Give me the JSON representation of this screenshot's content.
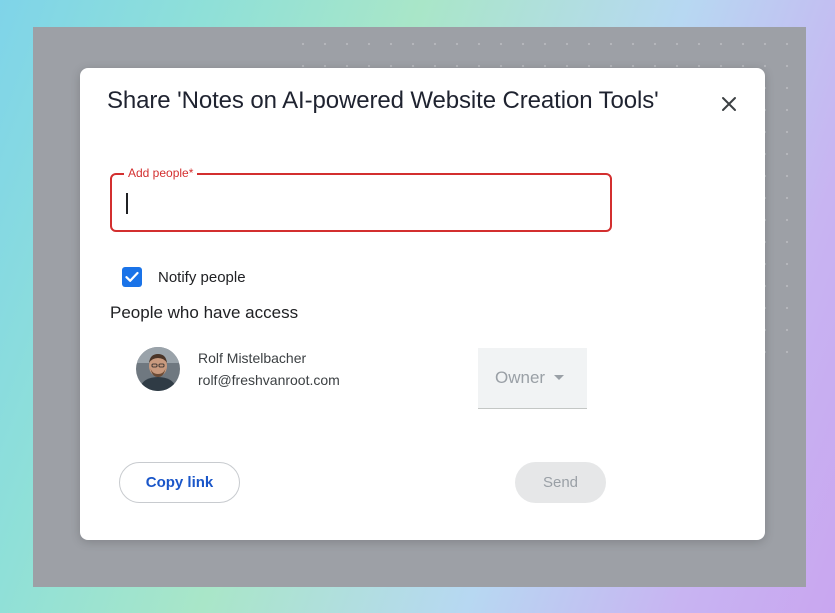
{
  "dialog": {
    "title": "Share 'Notes on AI-powered Website Creation Tools'",
    "close_icon": "close-icon"
  },
  "add_people": {
    "label": "Add people*",
    "value": "",
    "state": "error",
    "border_color": "#d32f2f"
  },
  "notify": {
    "label": "Notify people",
    "checked": true,
    "color": "#1a73e8"
  },
  "access": {
    "heading": "People who have access",
    "people": [
      {
        "name": "Rolf Mistelbacher",
        "email": "rolf@freshvanroot.com",
        "role": "Owner",
        "role_icon": "caret-down-icon"
      }
    ]
  },
  "actions": {
    "copy_link_label": "Copy link",
    "send_label": "Send",
    "send_enabled": false,
    "accent_color": "#1a56c9"
  }
}
